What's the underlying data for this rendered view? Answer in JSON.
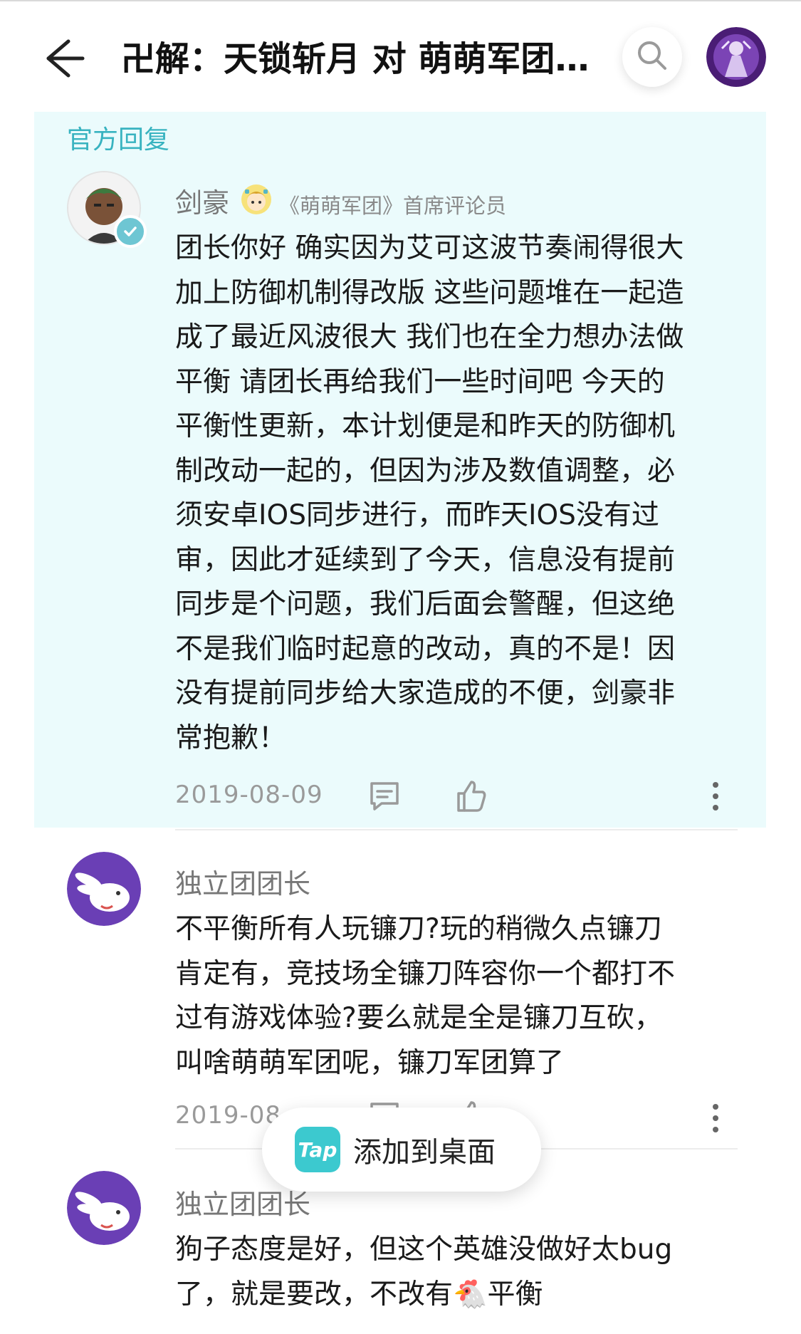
{
  "header": {
    "title": "卍解：天锁斩月 对 萌萌军团：..."
  },
  "official_reply": {
    "label": "官方回复",
    "author": "剑豪",
    "badge": "《萌萌军团》首席评论员",
    "lines": [
      "团长你好 确实因为艾可这波节奏闹得很大",
      "加上防御机制得改版 这些问题堆在一起造",
      "成了最近风波很大 我们也在全力想办法做",
      "平衡 请团长再给我们一些时间吧 今天的",
      "平衡性更新，本计划便是和昨天的防御机",
      "制改动一起的，但因为涉及数值调整，必",
      "须安卓IOS同步进行，而昨天IOS没有过",
      "审，因此才延续到了今天，信息没有提前",
      "同步是个问题，我们后面会警醒，但这绝",
      "不是我们临时起意的改动，真的不是！因",
      "没有提前同步给大家造成的不便，剑豪非",
      "常抱歉！"
    ],
    "date": "2019-08-09"
  },
  "reply1": {
    "author": "独立团团长",
    "lines": [
      "不平衡所有人玩镰刀?玩的稍微久点镰刀",
      "肯定有，竞技场全镰刀阵容你一个都打不",
      "过有游戏体验?要么就是全是镰刀互砍，",
      "叫啥萌萌军团呢，镰刀军团算了"
    ],
    "date": "2019-08"
  },
  "reply2": {
    "author": "独立团团长",
    "lines": [
      "狗子态度是好，但这个英雄没做好太bug",
      "了，就是要改，不改有🐔平衡"
    ]
  },
  "toast": {
    "logo": "Tap",
    "text": "添加到桌面"
  },
  "colors": {
    "official_bg": "#ebfbfc",
    "accent": "#38b3c0",
    "rabbit_purple": "#6a3fb5"
  }
}
